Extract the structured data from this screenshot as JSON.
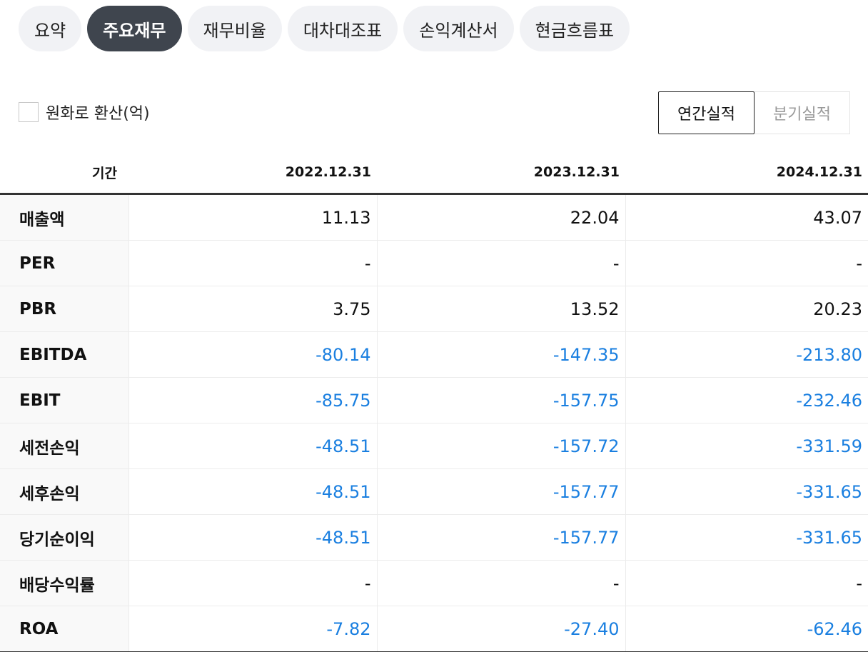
{
  "tabs": [
    "요약",
    "주요재무",
    "재무비율",
    "대차대조표",
    "손익계산서",
    "현금흐름표"
  ],
  "active_tab": "주요재무",
  "convert_label": "원화로 환산(억)",
  "period": {
    "annual": "연간실적",
    "quarterly": "분기실적"
  },
  "table": {
    "header_label": "기간",
    "periods": [
      "2022.12.31",
      "2023.12.31",
      "2024.12.31"
    ],
    "rows": [
      {
        "label": "매출액",
        "values": [
          "11.13",
          "22.04",
          "43.07"
        ]
      },
      {
        "label": "PER",
        "values": [
          "-",
          "-",
          "-"
        ]
      },
      {
        "label": "PBR",
        "values": [
          "3.75",
          "13.52",
          "20.23"
        ]
      },
      {
        "label": "EBITDA",
        "values": [
          "-80.14",
          "-147.35",
          "-213.80"
        ]
      },
      {
        "label": "EBIT",
        "values": [
          "-85.75",
          "-157.75",
          "-232.46"
        ]
      },
      {
        "label": "세전손익",
        "values": [
          "-48.51",
          "-157.72",
          "-331.59"
        ]
      },
      {
        "label": "세후손익",
        "values": [
          "-48.51",
          "-157.77",
          "-331.65"
        ]
      },
      {
        "label": "당기순이익",
        "values": [
          "-48.51",
          "-157.77",
          "-331.65"
        ]
      },
      {
        "label": "배당수익률",
        "values": [
          "-",
          "-",
          "-"
        ]
      },
      {
        "label": "ROA",
        "values": [
          "-7.82",
          "-27.40",
          "-62.46"
        ]
      }
    ]
  },
  "colors": {
    "negative": "#1a7fe0",
    "active_tab_bg": "#3f454e"
  }
}
